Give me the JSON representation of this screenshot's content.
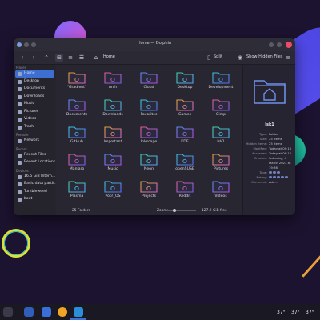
{
  "window": {
    "title": "Home — Dolphin",
    "toolbar": {
      "back_icon": "chevron-left-icon",
      "forward_icon": "chevron-right-icon",
      "breadcrumb": "Home",
      "split_label": "Split",
      "hidden_label": "Show Hidden Files"
    }
  },
  "sidebar": {
    "sections": [
      {
        "header": "Places",
        "items": [
          "Home",
          "Desktop",
          "Documents",
          "Downloads",
          "Music",
          "Pictures",
          "Videos",
          "Trash"
        ]
      },
      {
        "header": "Remote",
        "items": [
          "Network"
        ]
      },
      {
        "header": "Recent",
        "items": [
          "Recent Files",
          "Recent Locations"
        ]
      },
      {
        "header": "Devices",
        "items": [
          "16.5 GiB Intern...",
          "Basic data partit...",
          "Tumbleweed",
          "boot"
        ]
      }
    ],
    "active": "Home"
  },
  "folders": [
    "\"Gradient\"",
    "Arch",
    "Cloud",
    "Desktop",
    "Development",
    "Documents",
    "Downloads",
    "Favorites",
    "Games",
    "Gimp",
    "GitHub",
    "Important",
    "Inkscape",
    "KDE",
    "lsk1",
    "Manjaro",
    "Music",
    "Neon",
    "openSUSE",
    "Pictures",
    "Plasma",
    "Pop!_OS",
    "Projects",
    "Reddit",
    "Videos"
  ],
  "status": {
    "count": "25 Folders",
    "zoom_label": "Zoom:",
    "free": "127.2 GiB free"
  },
  "info": {
    "name": "lsk1",
    "rows": [
      {
        "k": "Type:",
        "v": "Folder"
      },
      {
        "k": "Size:",
        "v": "25 items"
      },
      {
        "k": "Hidden items:",
        "v": "25 items"
      },
      {
        "k": "Modified:",
        "v": "Today at 09:10"
      },
      {
        "k": "Accessed:",
        "v": "Today at 09:10"
      },
      {
        "k": "Created:",
        "v": "Saturday, 4"
      },
      {
        "k": "",
        "v": "March 2023 at"
      },
      {
        "k": "",
        "v": "19:36"
      },
      {
        "k": "Tags:",
        "v": ""
      },
      {
        "k": "Rating:",
        "v": ""
      },
      {
        "k": "Comment:",
        "v": "Add..."
      }
    ]
  },
  "taskbar": {
    "temps": [
      "37°",
      "37°",
      "37°"
    ]
  },
  "colors": {
    "accent": "#3c6fd1",
    "close": "#e94b6a"
  }
}
